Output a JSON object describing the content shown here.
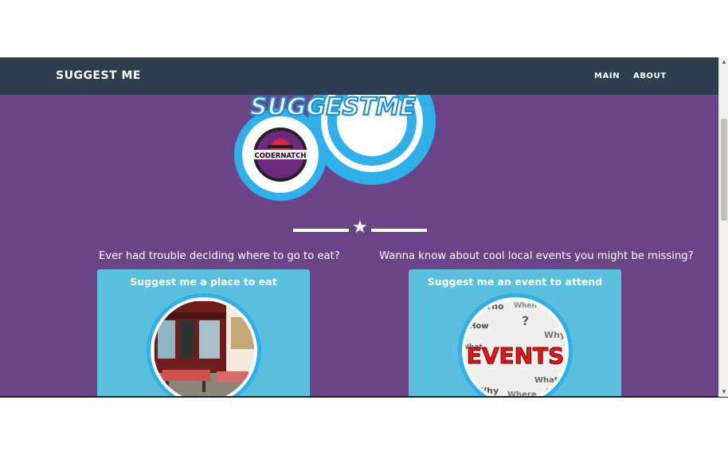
{
  "navbar": {
    "brand": "SUGGEST ME",
    "links": [
      "MAIN",
      "ABOUT"
    ]
  },
  "hero": {
    "logo_text": "SUGGESTME",
    "badge_text": "CODERNATCH"
  },
  "sections": [
    {
      "question": "Ever had trouble deciding where to go to eat?",
      "card_title": "Suggest me a place to eat",
      "image": "restaurant-photo"
    },
    {
      "question": "Wanna know about cool local events you might be missing?",
      "card_title": "Suggest me an event to attend",
      "image": "events-word-cloud",
      "image_text": "EVENTS",
      "image_words": [
        "Who",
        "How",
        "When",
        "Why",
        "What",
        "Where",
        "?"
      ]
    }
  ],
  "colors": {
    "navbar_bg": "#2c3e50",
    "page_bg": "#6b4487",
    "card_bg": "#5bc0de",
    "logo_ring": "#2fb0ea"
  }
}
